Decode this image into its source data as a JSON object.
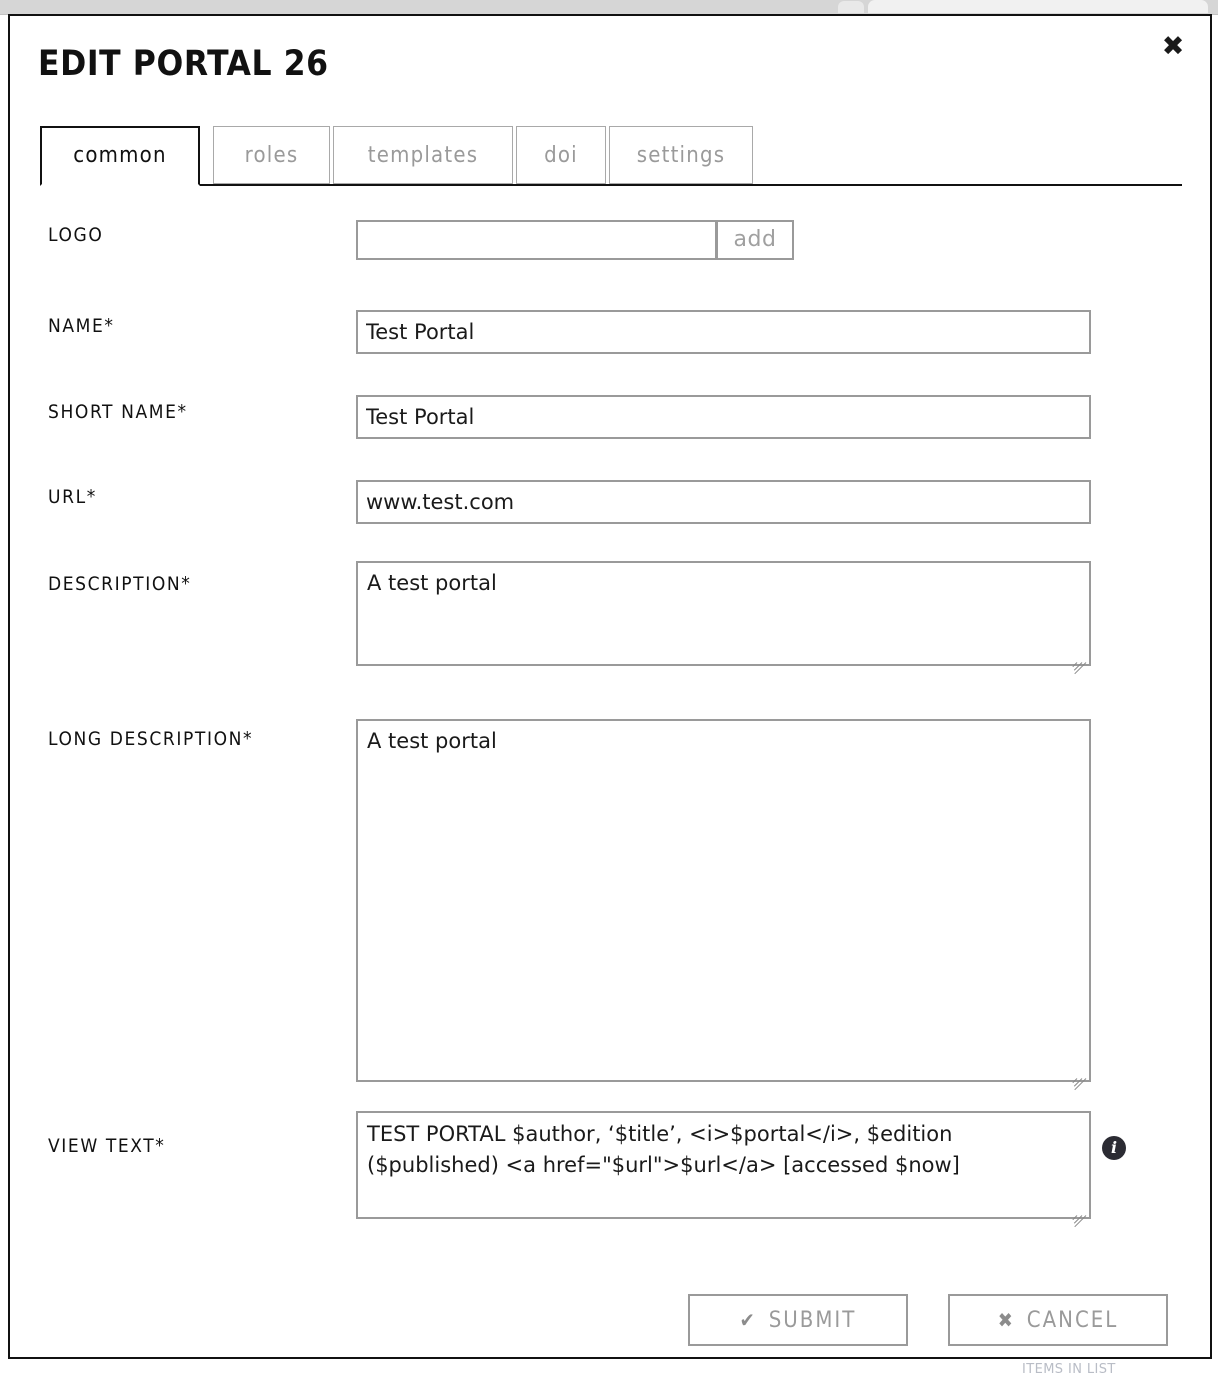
{
  "window": {
    "close_label": "✖",
    "title": "EDIT PORTAL 26"
  },
  "tabs": [
    {
      "label": "common",
      "active": true
    },
    {
      "label": "roles",
      "active": false
    },
    {
      "label": "templates",
      "active": false
    },
    {
      "label": "doi",
      "active": false
    },
    {
      "label": "settings",
      "active": false
    }
  ],
  "form": {
    "logo": {
      "label": "LOGO",
      "value": "",
      "placeholder": "",
      "add_label": "add"
    },
    "name": {
      "label": "NAME*",
      "value": "Test Portal",
      "placeholder": ""
    },
    "short_name": {
      "label": "SHORT NAME*",
      "value": "Test Portal",
      "placeholder": ""
    },
    "url": {
      "label": "URL*",
      "value": "www.test.com",
      "placeholder": ""
    },
    "description": {
      "label": "DESCRIPTION*",
      "value": "A test portal",
      "placeholder": ""
    },
    "long_description": {
      "label": "LONG DESCRIPTION*",
      "value": "A test portal",
      "placeholder": ""
    },
    "view_text": {
      "label": "VIEW TEXT*",
      "value": "TEST PORTAL $author, ‘$title’, <i>$portal</i>, $edition ($published) <a href=\"$url\">$url</a> [accessed $now]",
      "placeholder": "",
      "info_glyph": "i"
    }
  },
  "footer": {
    "submit_label": "SUBMIT",
    "submit_icon": "✔",
    "cancel_label": "CANCEL",
    "cancel_icon": "✖"
  },
  "underlay": {
    "cut_text": "ITEMS IN LIST"
  },
  "colors": {
    "modal_border": "#111111",
    "field_border": "#9a9a9a",
    "muted_text": "#9a9a9a",
    "text": "#111111",
    "info_badge": "#2b2b33"
  }
}
